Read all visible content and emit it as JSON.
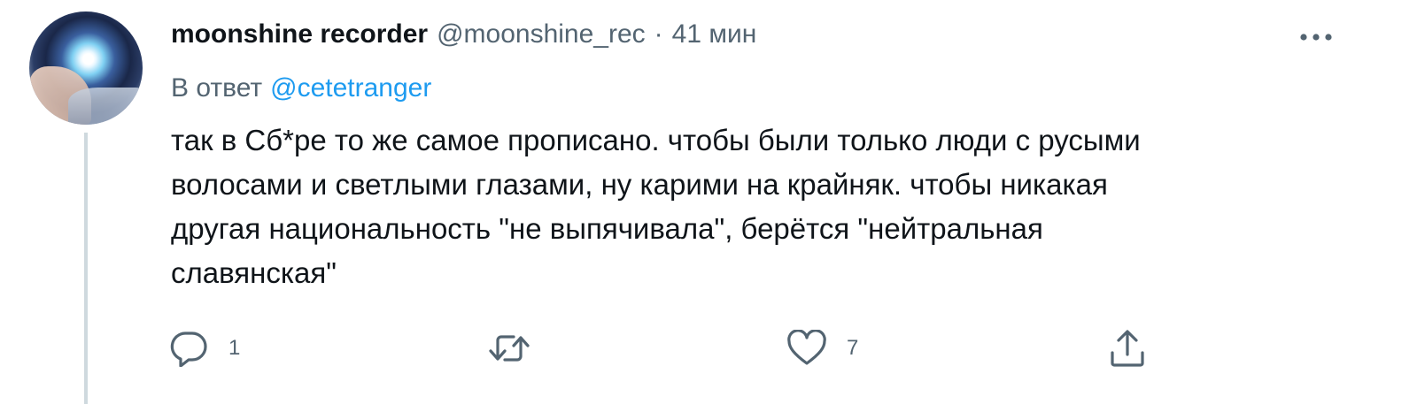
{
  "tweet": {
    "author": {
      "display_name": "moonshine recorder",
      "handle": "@moonshine_rec"
    },
    "separator": "·",
    "time": "41 мин",
    "reply_to": {
      "prefix": "В ответ",
      "mention": "@cetetranger"
    },
    "text_lines": [
      "так в Сб*ре то же самое прописано. чтобы были только люди с русыми",
      "волосами и светлыми глазами, ну карими на крайняк. чтобы никакая",
      "другая национальность \"не выпячивала\", берётся \"нейтральная",
      "славянская\""
    ],
    "actions": {
      "reply": {
        "icon": "reply-icon",
        "count": "1"
      },
      "retweet": {
        "icon": "retweet-icon",
        "count": ""
      },
      "like": {
        "icon": "heart-icon",
        "count": "7"
      },
      "share": {
        "icon": "share-icon"
      }
    },
    "more_icon": "more-icon"
  },
  "colors": {
    "text_primary": "#0f1419",
    "text_secondary": "#536471",
    "link": "#1d9bf0",
    "thread_line": "#cfd9de"
  }
}
